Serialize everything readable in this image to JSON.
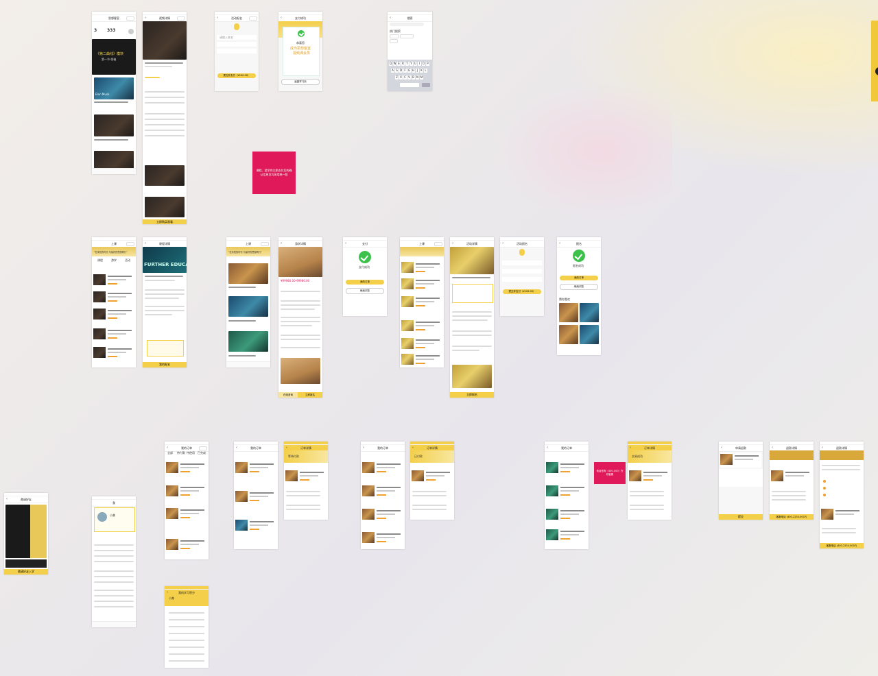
{
  "row1": {
    "s1": {
      "title": "思想客室",
      "stat1": "3",
      "stat2": "333",
      "banner_text": "《第二曲线》模块",
      "banner_sub": "第一节·领袖",
      "tag": "Elon Musk"
    },
    "s2": {
      "title": "视频详情",
      "cta": "立即购买观看"
    },
    "s3": {
      "title": "活动报名",
      "placeholder_name": "请输入姓名",
      "cta": "提交并支付（¥100.00）"
    },
    "s4": {
      "title": "支付成功",
      "line1": "恭喜您",
      "line2": "成为思想客室",
      "line3": "视频课会员",
      "cta": "返回学习页"
    },
    "s5": {
      "title": "搜索",
      "hot": "热门搜索"
    }
  },
  "pink_note_1": "课程、游学的立即支付后的确认信息页均采用统一版",
  "pink_note_2": "电话咨询（400-000）在线客服",
  "row2": {
    "s1": {
      "title": "上课",
      "quote": "\"在未知的时代 与最好的思想同行\"",
      "tabs": [
        "课程",
        "游学",
        "活动"
      ]
    },
    "s2": {
      "title": "课程详情",
      "hero": "FURTHER EDUCATION",
      "cta": "我的报名"
    },
    "s3": {
      "title": "上课",
      "quote": "\"在未知的时代 与最好的思想同行\""
    },
    "s4": {
      "title": "游学详情",
      "price": "¥99980.00-99980.00",
      "btn_left": "在线咨询",
      "btn_right": "立即报名"
    },
    "s5": {
      "title": "支付",
      "msg": "支付成功",
      "btn1": "我的订单",
      "btn2": "继续浏览"
    },
    "s6": {
      "title": "上课"
    },
    "s7": {
      "title": "活动详情",
      "cta": "立即报名"
    },
    "s8": {
      "title": "活动报名",
      "cta": "提交并支付（¥100.00）"
    },
    "s9": {
      "title": "报名",
      "msg": "报名成功",
      "btn1": "我的订单",
      "btn2": "继续浏览",
      "more": "猜你喜欢"
    }
  },
  "row3": {
    "share": {
      "title": "邀请好友",
      "cta": "邀请好友入学"
    },
    "me": {
      "title": "我",
      "name": "小美"
    },
    "orders1": {
      "title": "我的订单",
      "tabs": [
        "全部",
        "待付款",
        "待使用",
        "已完成"
      ]
    },
    "orders2": {
      "title": "我的订单"
    },
    "detail1": {
      "title": "订单详情",
      "status": "等待付款"
    },
    "orders3": {
      "title": "我的订单"
    },
    "detail2": {
      "title": "订单详情",
      "status": "已付款"
    },
    "orders4": {
      "title": "我的订单"
    },
    "detail3": {
      "title": "订单详情",
      "status": "交易成功"
    },
    "refund1": {
      "title": "申请退款",
      "cta": "提交"
    },
    "refund2": {
      "title": "退款详情",
      "cta": "客服电话 (400-2234-0007)"
    },
    "refund3": {
      "title": "退款详情",
      "cta": "客服电话 (400-2234-0007)"
    },
    "rank": {
      "title": "我的学习积分",
      "name": "小美"
    }
  }
}
